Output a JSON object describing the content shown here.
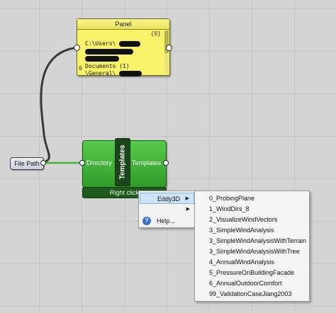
{
  "panel": {
    "title": "Panel",
    "count": "{0}",
    "index": "0",
    "lines": [
      "C:\\Users\\",
      "",
      "Documents (1)",
      "\\General\\"
    ]
  },
  "file_path": {
    "label": "File Path"
  },
  "templates": {
    "name": "Templates",
    "input": "Directory",
    "output": "Templates",
    "bar_text": "Right click"
  },
  "context_menu": {
    "items": [
      "Eddy3D",
      "",
      "Help..."
    ]
  },
  "submenu": {
    "items": [
      "0_ProbingPlane",
      "1_WindDirs_8",
      "2_VisualizeWindVectors",
      "3_SimpleWindAnalysis",
      "3_SimpleWindAnalysisWithTerrain",
      "3_SimpleWindAnalysisWithTree",
      "4_AnnualWindAnalysis",
      "5_PressureOnBuildingFacade",
      "6_AnnualOutdoorComfort",
      "99_ValidationCaseJiang2003"
    ]
  },
  "colors": {
    "panel": "#f7f26a",
    "component": "#3fae36",
    "menu_highlight": "#cfe3f7"
  },
  "icons": {
    "help": "help-icon",
    "submenu": "chevron-right-icon"
  }
}
